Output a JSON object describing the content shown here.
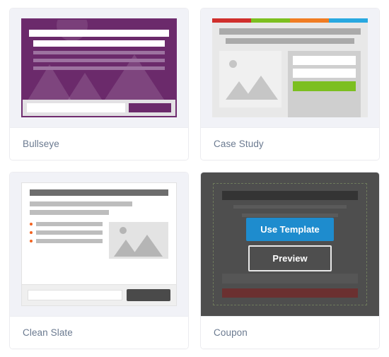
{
  "gallery": {
    "cards": [
      {
        "id": "bullseye",
        "label": "Bullseye",
        "accent": "#6b2a6b",
        "state": "default"
      },
      {
        "id": "case-study",
        "label": "Case Study",
        "accent": "#7cbf20",
        "state": "default",
        "colorbar": [
          "#d02f2c",
          "#7cbf20",
          "#f07c23",
          "#28a8e0"
        ]
      },
      {
        "id": "clean-slate",
        "label": "Clean Slate",
        "accent": "#f26321",
        "state": "default"
      },
      {
        "id": "coupon",
        "label": "Coupon",
        "accent": "#6b3030",
        "state": "hover"
      }
    ]
  },
  "hover_actions": {
    "use_template_label": "Use Template",
    "preview_label": "Preview",
    "use_template_color": "#1e8cce",
    "preview_border_color": "#e8e8e8",
    "overlay_color": "#4e4e4e"
  },
  "colors": {
    "page_background": "#ffffff",
    "card_background": "#ffffff",
    "thumb_background": "#f1f2f7",
    "label_text": "#6b7a90",
    "card_border": "#ececf0"
  }
}
